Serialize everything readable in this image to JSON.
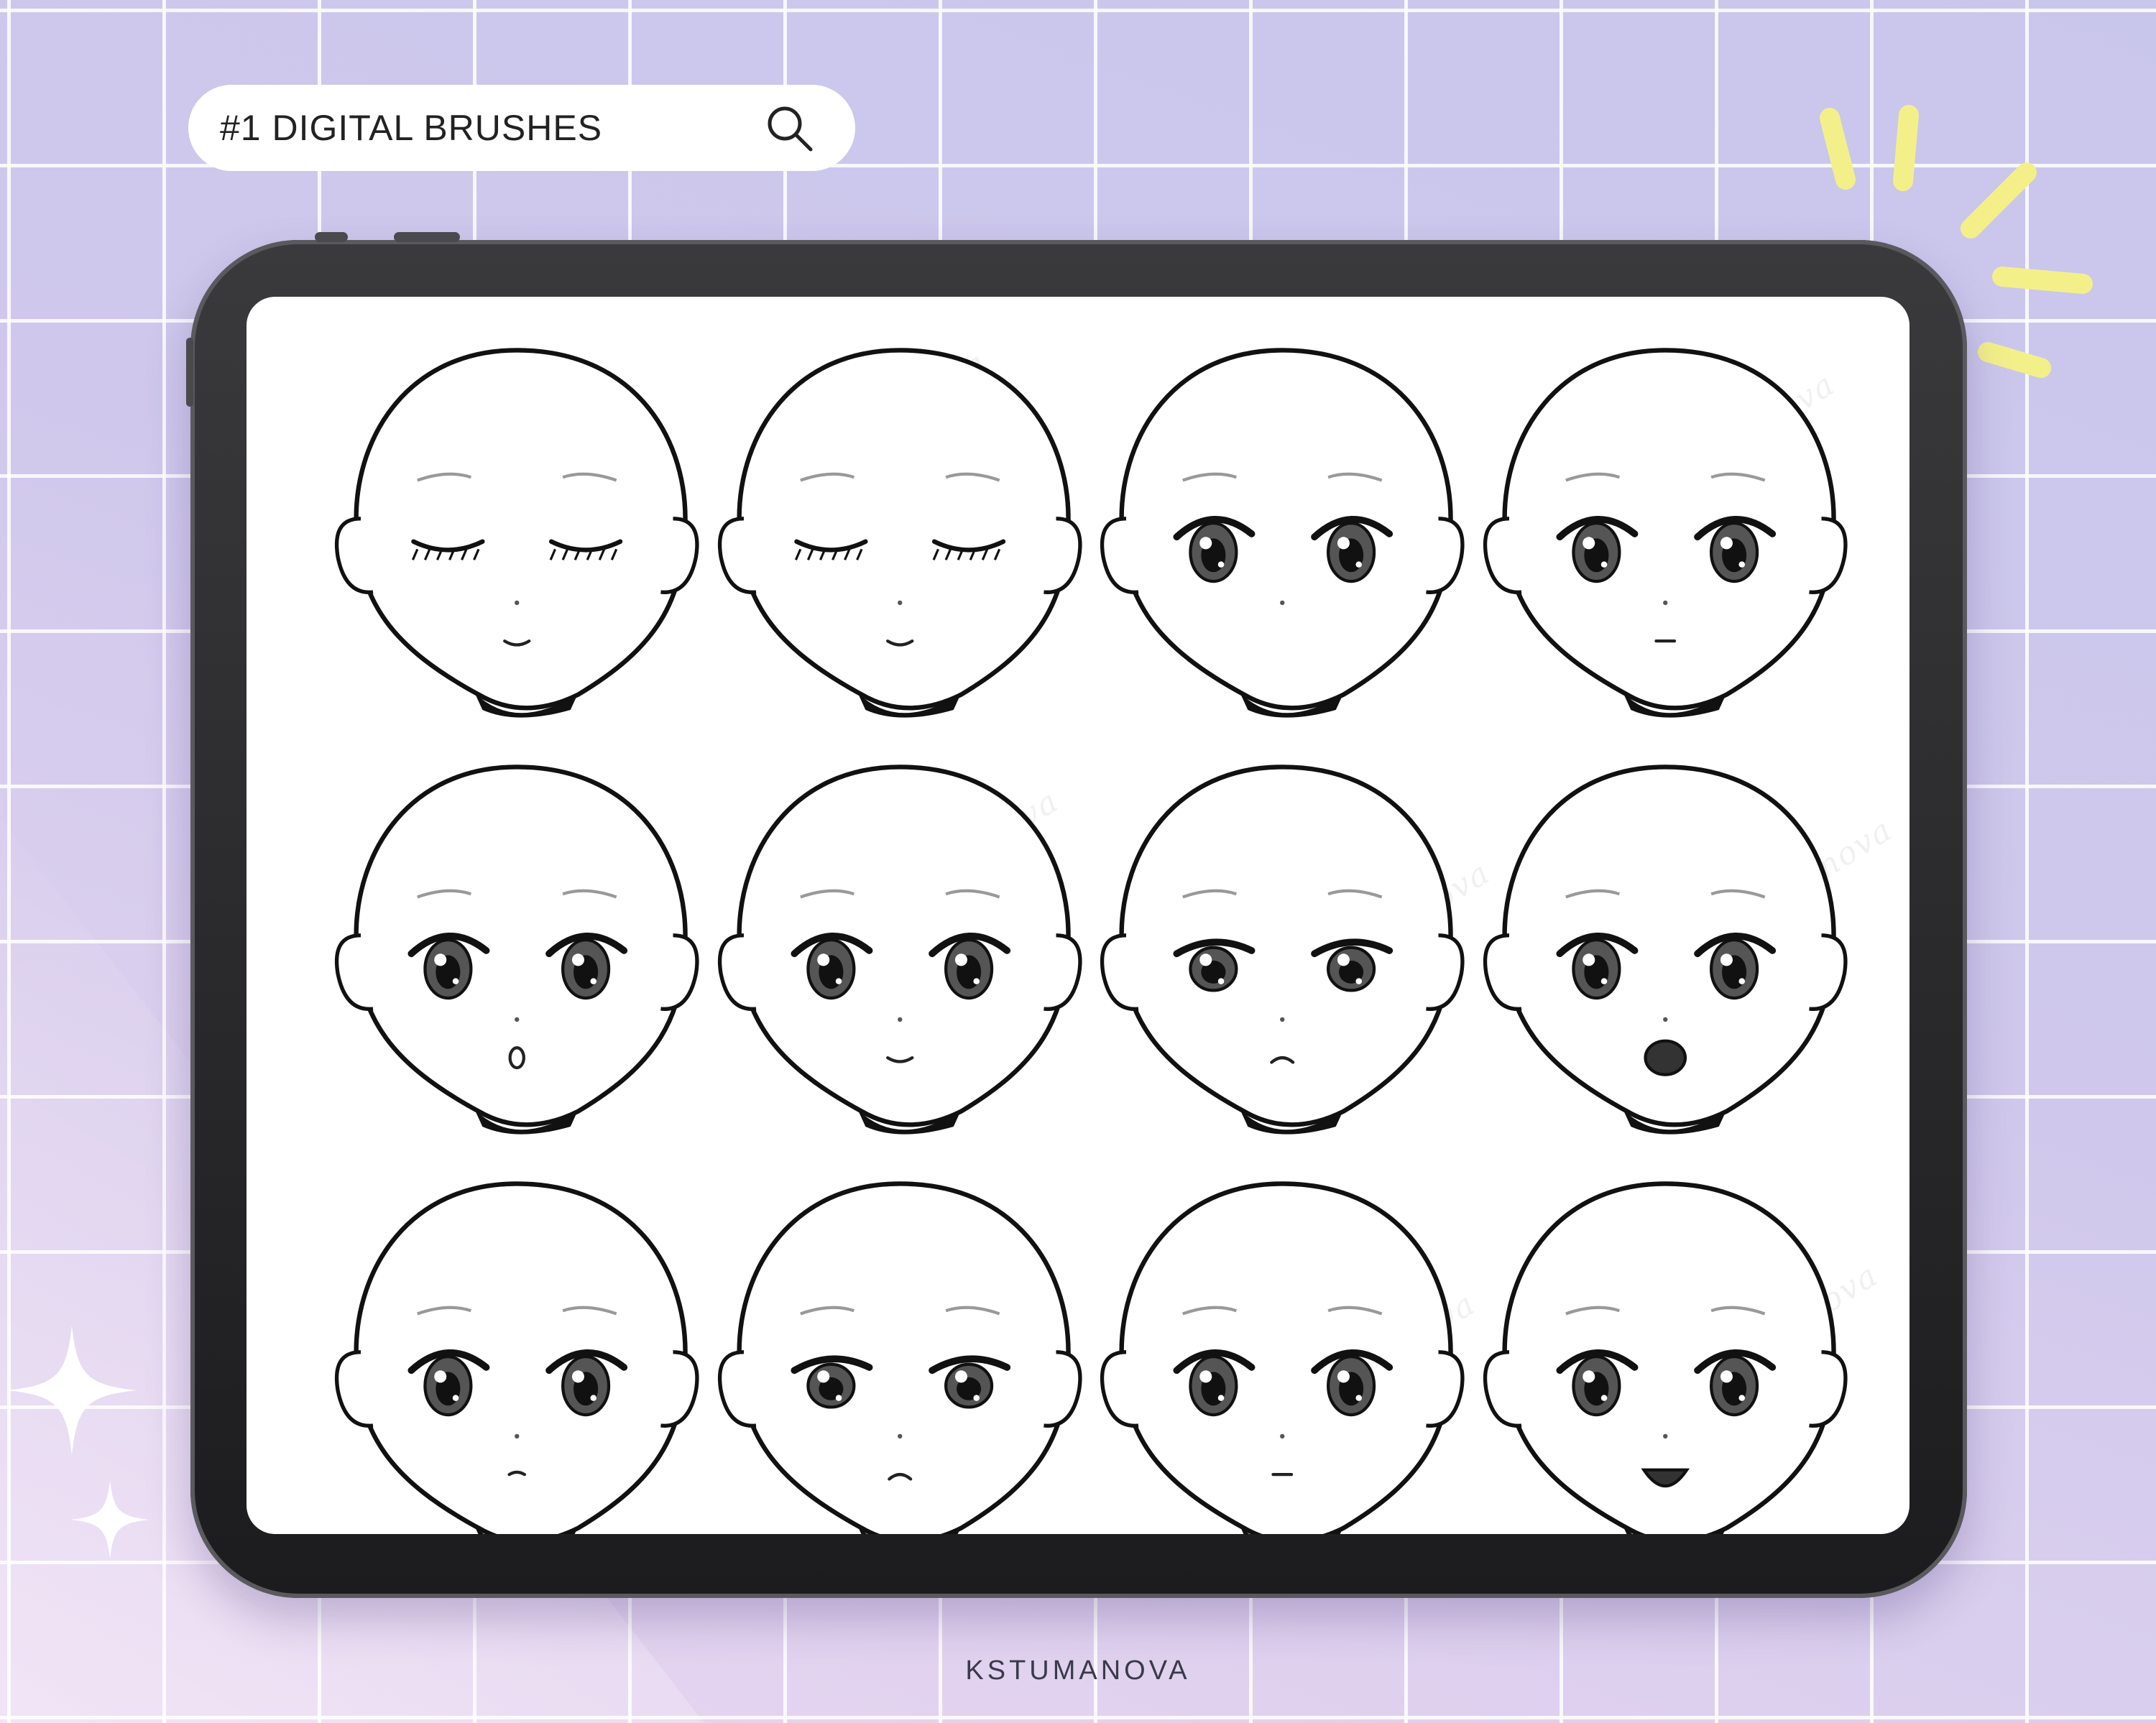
{
  "search": {
    "text": "#1 DIGITAL BRUSHES",
    "icon": "search-icon"
  },
  "footer": {
    "brand": "KSTUMANOVA"
  },
  "watermark": {
    "text": "Ks_Tumanova"
  },
  "artwork": {
    "rows": 3,
    "columns": 4,
    "heads": [
      {
        "eyes": "closed",
        "mouth": "smile"
      },
      {
        "eyes": "closed",
        "mouth": "smile"
      },
      {
        "eyes": "open",
        "mouth": "none"
      },
      {
        "eyes": "open",
        "mouth": "neutral"
      },
      {
        "eyes": "open",
        "mouth": "o"
      },
      {
        "eyes": "open",
        "mouth": "smile"
      },
      {
        "eyes": "half",
        "mouth": "frown"
      },
      {
        "eyes": "open",
        "mouth": "open"
      },
      {
        "eyes": "open",
        "mouth": "pout"
      },
      {
        "eyes": "half",
        "mouth": "frown"
      },
      {
        "eyes": "open",
        "mouth": "neutral"
      },
      {
        "eyes": "open",
        "mouth": "grin"
      }
    ]
  },
  "colors": {
    "background": "#cfc8ec",
    "tablet": "#2a2a2c",
    "accent_rays": "#f3f08a",
    "sparkle": "#ffffff"
  }
}
